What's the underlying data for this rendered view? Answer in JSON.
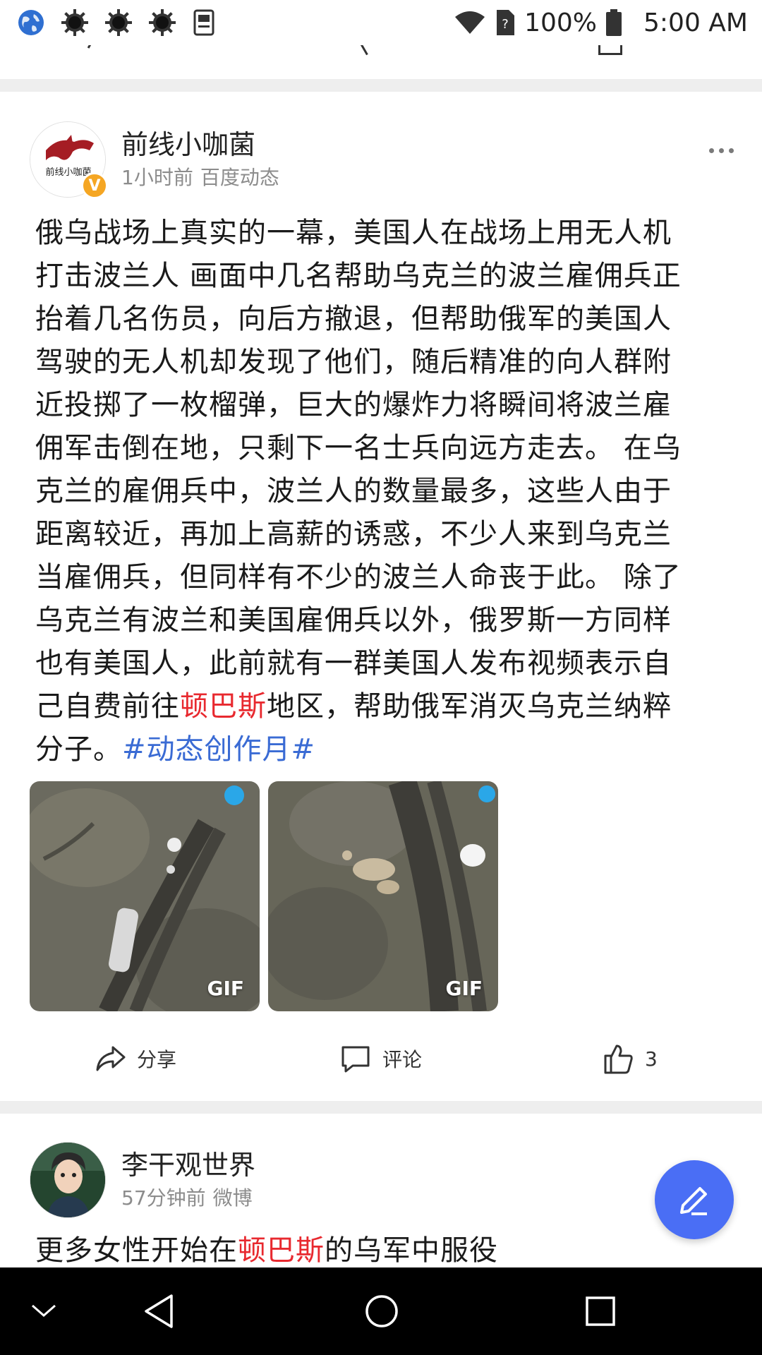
{
  "status_bar": {
    "battery": "100%",
    "time": "5:00 AM"
  },
  "posts": [
    {
      "author": "前线小咖菌",
      "avatar_text": "前线小咖菌",
      "verified_mark": "V",
      "time": "1小时前",
      "source": "百度动态",
      "text_lines": [
        "俄乌战场上真实的一幕，美国人在战场上用无人机",
        "打击波兰人 画面中几名帮助乌克兰的波兰雇佣兵正",
        "抬着几名伤员，向后方撤退，但帮助俄军的美国人",
        "驾驶的无人机却发现了他们，随后精准的向人群附",
        "近投掷了一枚榴弹，巨大的爆炸力将瞬间将波兰雇",
        "佣军击倒在地，只剩下一名士兵向远方走去。 在乌",
        "克兰的雇佣兵中，波兰人的数量最多，这些人由于",
        "距离较近，再加上高薪的诱惑，不少人来到乌克兰",
        "当雇佣兵，但同样有不少的波兰人命丧于此。 除了",
        "乌克兰有波兰和美国雇佣兵以外，俄罗斯一方同样",
        "也有美国人，此前就有一群美国人发布视频表示自"
      ],
      "line12_before": "己自费前往",
      "line12_link": "顿巴斯",
      "line12_after": "地区，帮助俄军消灭乌克兰纳粹",
      "line13_before": "分子。",
      "hashtag": "#动态创作月#",
      "media": [
        {
          "label": "GIF"
        },
        {
          "label": "GIF"
        }
      ],
      "actions": {
        "share": "分享",
        "comment": "评论",
        "like_count": "3"
      }
    },
    {
      "author": "李干观世界",
      "time": "57分钟前",
      "source": "微博",
      "text_before": "更多女性开始在",
      "text_link": "顿巴斯",
      "text_after": "的乌军中服役"
    }
  ],
  "colors": {
    "link_red": "#e8292f",
    "hashtag_blue": "#3a6bd4",
    "fab_blue": "#4a6ef5",
    "verified_orange": "#f5a623"
  },
  "icons": [
    "globe-icon",
    "gear-icon",
    "notes-icon",
    "wifi-icon",
    "sim-icon",
    "battery-icon",
    "share-icon",
    "comment-icon",
    "like-icon",
    "more-icon",
    "pencil-icon",
    "nav-chevron-down-icon",
    "nav-back-icon",
    "nav-home-icon",
    "nav-recents-icon"
  ]
}
